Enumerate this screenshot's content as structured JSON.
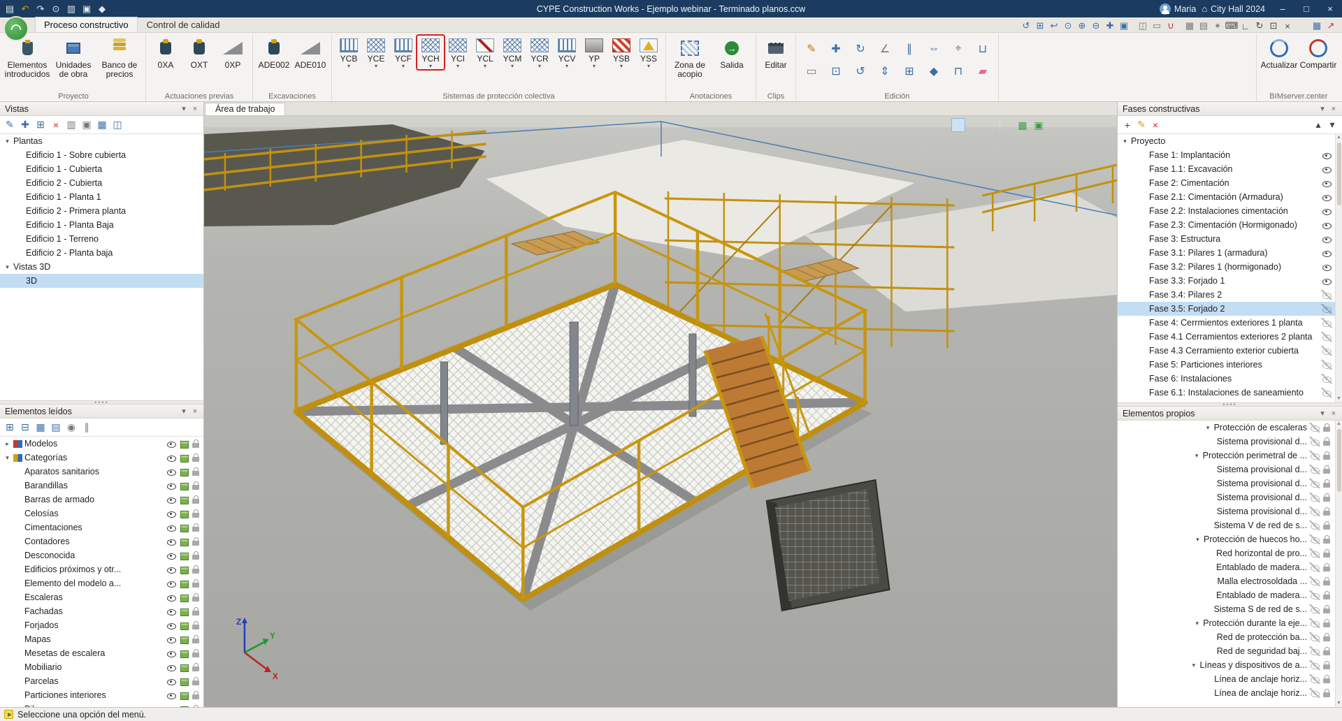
{
  "titlebar": {
    "title": "CYPE Construction Works - Ejemplo webinar - Terminado planos.ccw",
    "user": "Maria",
    "project": "City Hall 2024",
    "icons": [
      {
        "name": "save-icon",
        "glyph": "▤",
        "tone": "light"
      },
      {
        "name": "undo-icon",
        "glyph": "↶",
        "tone": "yellow"
      },
      {
        "name": "redo-icon",
        "glyph": "↷",
        "tone": "light"
      },
      {
        "name": "zoom-icon",
        "glyph": "⊙",
        "tone": "light"
      },
      {
        "name": "print-icon",
        "glyph": "▥",
        "tone": "light"
      },
      {
        "name": "capture-icon",
        "glyph": "▣",
        "tone": "light"
      },
      {
        "name": "settings-icon",
        "glyph": "◆",
        "tone": "light"
      }
    ],
    "window_controls": [
      {
        "name": "minimize-button",
        "glyph": "–"
      },
      {
        "name": "maximize-button",
        "glyph": "□"
      },
      {
        "name": "close-button",
        "glyph": "×"
      }
    ]
  },
  "ribbon_tabs": [
    {
      "label": "Proceso constructivo",
      "active": true
    },
    {
      "label": "Control de calidad"
    }
  ],
  "tabrow_icons": [
    {
      "name": "refresh-view-icon",
      "glyph": "↺",
      "tone": "blue"
    },
    {
      "name": "zoom-window-icon",
      "glyph": "⊞",
      "tone": "blue"
    },
    {
      "name": "zoom-previous-icon",
      "glyph": "↩",
      "tone": "blue"
    },
    {
      "name": "magnifier-icon",
      "glyph": "⊙",
      "tone": "blue"
    },
    {
      "name": "zoom-in-icon",
      "glyph": "⊕",
      "tone": "blue"
    },
    {
      "name": "zoom-out-icon",
      "glyph": "⊖",
      "tone": "blue"
    },
    {
      "name": "pan-icon",
      "glyph": "✚",
      "tone": "blue"
    },
    {
      "name": "full-view-icon",
      "glyph": "▣",
      "tone": "blue"
    },
    {
      "sep": true
    },
    {
      "name": "tile-windows-icon",
      "glyph": "◫",
      "tone": "gray"
    },
    {
      "name": "new-window-icon",
      "glyph": "▭",
      "tone": "gray"
    },
    {
      "name": "magnet-icon",
      "glyph": "∪",
      "tone": "red"
    },
    {
      "sep": true
    },
    {
      "name": "frame-icon",
      "glyph": "▦",
      "tone": "gray"
    },
    {
      "name": "grid-icon",
      "glyph": "▤",
      "tone": "gray"
    },
    {
      "name": "snap-icon",
      "glyph": "⌖",
      "tone": "dark"
    },
    {
      "name": "keyboard-icon",
      "glyph": "⌨",
      "tone": "dark"
    },
    {
      "name": "ruler-icon",
      "glyph": "∟",
      "tone": "dark"
    },
    {
      "name": "orbit-icon",
      "glyph": "↻",
      "tone": "dark"
    },
    {
      "name": "comment-icon",
      "glyph": "⊡",
      "tone": "dark"
    },
    {
      "name": "close-tool-icon",
      "glyph": "×",
      "tone": "dark"
    },
    {
      "gap": true
    },
    {
      "name": "bim-windows-icon",
      "glyph": "▦",
      "tone": "blue"
    },
    {
      "name": "share-view-icon",
      "glyph": "↗",
      "tone": "red"
    }
  ],
  "ribbon": {
    "proyecto": {
      "label": "Proyecto",
      "buttons": [
        {
          "label": "Elementos introducidos",
          "icon": "elements"
        },
        {
          "label": "Unidades de obra",
          "icon": "units"
        },
        {
          "label": "Banco de precios",
          "icon": "prices"
        }
      ]
    },
    "actuaciones": {
      "label": "Actuaciones previas",
      "buttons": [
        {
          "label": "0XA",
          "icon": "ink"
        },
        {
          "label": "OXT",
          "icon": "ink"
        },
        {
          "label": "0XP",
          "icon": "ramp"
        }
      ]
    },
    "excavaciones": {
      "label": "Excavaciones",
      "buttons": [
        {
          "label": "ADE002",
          "icon": "ink"
        },
        {
          "label": "ADE010",
          "icon": "ramp"
        }
      ]
    },
    "proteccion": {
      "label": "Sistemas de protección colectiva",
      "buttons": [
        {
          "code": "YCB",
          "icon": "fence"
        },
        {
          "code": "YCE",
          "icon": "net"
        },
        {
          "code": "YCF",
          "icon": "fence"
        },
        {
          "code": "YCH",
          "icon": "net",
          "highlighted": true
        },
        {
          "code": "YCI",
          "icon": "net"
        },
        {
          "code": "YCL",
          "icon": "line"
        },
        {
          "code": "YCM",
          "icon": "net"
        },
        {
          "code": "YCR",
          "icon": "net"
        },
        {
          "code": "YCV",
          "icon": "fence"
        },
        {
          "code": "YP",
          "icon": "platform"
        },
        {
          "code": "YSB",
          "icon": "stripes"
        },
        {
          "code": "YSS",
          "icon": "sign"
        }
      ]
    },
    "anotaciones": {
      "label": "Anotaciones",
      "buttons": [
        {
          "label": "Zona de acopio",
          "icon": "zone"
        },
        {
          "label": "Salida",
          "icon": "exit"
        }
      ]
    },
    "clips": {
      "label": "Clips",
      "buttons": [
        {
          "label": "Editar",
          "icon": "clip"
        }
      ]
    },
    "edicion": {
      "label": "Edición",
      "tools": [
        {
          "name": "edit-tool-icon",
          "glyph": "✎",
          "tone": "orange"
        },
        {
          "name": "rectangle-tool-icon",
          "glyph": "▭",
          "tone": "gray"
        },
        {
          "name": "move-tool-icon",
          "glyph": "✚",
          "tone": "blue"
        },
        {
          "name": "copy-tool-icon",
          "glyph": "⊡",
          "tone": "blue"
        },
        {
          "name": "rotate-tool-icon",
          "glyph": "↻",
          "tone": "blue"
        },
        {
          "name": "rotate-ccw-tool-icon",
          "glyph": "↺",
          "tone": "blue"
        },
        {
          "name": "measure-tool-icon",
          "glyph": "∠",
          "tone": "gray"
        },
        {
          "name": "stretch-tool-icon",
          "glyph": "⇕",
          "tone": "blue"
        },
        {
          "name": "align-tool-icon",
          "glyph": "∥",
          "tone": "blue"
        },
        {
          "name": "grid-snap-tool-icon",
          "glyph": "⊞",
          "tone": "blue"
        },
        {
          "name": "mirror-tool-icon",
          "glyph": "⇔",
          "tone": "blue"
        },
        {
          "name": "diamond-tool-icon",
          "glyph": "◆",
          "tone": "blue"
        },
        {
          "name": "dimension-tool-icon",
          "glyph": "⌖",
          "tone": "gray"
        },
        {
          "name": "join-tool-icon",
          "glyph": "⊓",
          "tone": "blue"
        },
        {
          "name": "divide-tool-icon",
          "glyph": "⊔",
          "tone": "blue"
        },
        {
          "name": "eraser-tool-icon",
          "glyph": "▰",
          "tone": "pink"
        }
      ]
    },
    "bimserver": {
      "label": "BIMserver.center",
      "buttons": [
        {
          "label": "Actualizar",
          "icon": "sync"
        },
        {
          "label": "Compartir",
          "icon": "share"
        }
      ]
    }
  },
  "workspace": {
    "tab": "Área de trabajo",
    "toolbar": [
      {
        "name": "projection-icon",
        "glyph": "△"
      },
      {
        "name": "perspective-icon",
        "glyph": "◇",
        "active": true
      },
      {
        "name": "visibility-icon",
        "glyph": "◉"
      },
      {
        "name": "orbit-icon",
        "glyph": "↻"
      },
      {
        "sep": true
      },
      {
        "name": "analytical-model-icon",
        "glyph": "▦",
        "tone": "green"
      },
      {
        "name": "solid-view-icon",
        "glyph": "▣",
        "tone": "green"
      },
      {
        "name": "background-icon",
        "glyph": "▭"
      },
      {
        "name": "layers-icon",
        "glyph": "≡"
      },
      {
        "name": "hide-elements-icon",
        "glyph": "◌"
      },
      {
        "name": "isolate-icon",
        "glyph": "◆"
      }
    ],
    "axis_labels": {
      "x": "X",
      "y": "Y",
      "z": "Z"
    }
  },
  "panels": {
    "vistas": {
      "title": "Vistas",
      "toolbar": [
        {
          "name": "edit-view-icon",
          "glyph": "✎",
          "tone": "blue"
        },
        {
          "name": "new-view-icon",
          "glyph": "✚",
          "tone": "blue"
        },
        {
          "name": "duplicate-view-icon",
          "glyph": "⊞",
          "tone": "blue"
        },
        {
          "name": "delete-view-icon",
          "glyph": "×",
          "tone": "red"
        },
        {
          "name": "print-view-icon",
          "glyph": "▥",
          "tone": "gray"
        },
        {
          "name": "capture-view-icon",
          "glyph": "▣",
          "tone": "gray"
        },
        {
          "name": "layers-view-icon",
          "glyph": "▦",
          "tone": "blue"
        },
        {
          "name": "export-view-icon",
          "glyph": "◫",
          "tone": "blue"
        }
      ],
      "items": [
        {
          "label": "Plantas",
          "arrow": "down"
        },
        {
          "label": "Edificio 1 - Sobre cubierta",
          "indent": 1
        },
        {
          "label": "Edificio 1 - Cubierta",
          "indent": 1
        },
        {
          "label": "Edificio 2 - Cubierta",
          "indent": 1
        },
        {
          "label": "Edificio 1 - Planta 1",
          "indent": 1
        },
        {
          "label": "Edificio 2 - Primera planta",
          "indent": 1
        },
        {
          "label": "Edificio 1 - Planta Baja",
          "indent": 1
        },
        {
          "label": "Edificio 1 - Terreno",
          "indent": 1
        },
        {
          "label": "Edificio 2 - Planta baja",
          "indent": 1
        },
        {
          "label": "Vistas 3D",
          "arrow": "down"
        },
        {
          "label": "3D",
          "indent": 1,
          "selected": true
        }
      ]
    },
    "leidos": {
      "title": "Elementos leídos",
      "toolbar": [
        {
          "name": "expand-all-icon",
          "glyph": "⊞",
          "tone": "blue"
        },
        {
          "name": "collapse-all-icon",
          "glyph": "⊟",
          "tone": "blue"
        },
        {
          "name": "show-all-icon",
          "glyph": "▦",
          "tone": "blue"
        },
        {
          "name": "hide-all-icon",
          "glyph": "▤",
          "tone": "blue"
        },
        {
          "name": "sphere-icon",
          "glyph": "◉",
          "tone": "gray"
        },
        {
          "name": "filter-icon",
          "glyph": "∥",
          "tone": "gray"
        }
      ],
      "items": [
        {
          "label": "Modelos",
          "arrow": "right",
          "icon": "models",
          "eye": "on",
          "cube": true,
          "lock": true
        },
        {
          "label": "Categorías",
          "arrow": "down",
          "icon": "categories",
          "eye": "on",
          "cube": true,
          "lock": true
        },
        {
          "label": "Aparatos sanitarios",
          "eye": "on",
          "cube": true,
          "lock": true
        },
        {
          "label": "Barandillas",
          "eye": "on",
          "cube": true,
          "lock": true
        },
        {
          "label": "Barras de armado",
          "eye": "on",
          "cube": true,
          "lock": true
        },
        {
          "label": "Celosías",
          "eye": "on",
          "cube": true,
          "lock": true
        },
        {
          "label": "Cimentaciones",
          "eye": "on",
          "cube": true,
          "lock": true
        },
        {
          "label": "Contadores",
          "eye": "on",
          "cube": true,
          "lock": true
        },
        {
          "label": "Desconocida",
          "eye": "on",
          "cube": true,
          "lock": true
        },
        {
          "label": "Edificios próximos y otr...",
          "eye": "on",
          "cube": true,
          "lock": true
        },
        {
          "label": "Elemento del modelo a...",
          "eye": "on",
          "cube": true,
          "lock": true
        },
        {
          "label": "Escaleras",
          "eye": "on",
          "cube": true,
          "lock": true
        },
        {
          "label": "Fachadas",
          "eye": "on",
          "cube": true,
          "lock": true
        },
        {
          "label": "Forjados",
          "eye": "on",
          "cube": true,
          "lock": true
        },
        {
          "label": "Mapas",
          "eye": "on",
          "cube": true,
          "lock": true
        },
        {
          "label": "Mesetas de escalera",
          "eye": "on",
          "cube": true,
          "lock": true
        },
        {
          "label": "Mobiliario",
          "eye": "on",
          "cube": true,
          "lock": true
        },
        {
          "label": "Parcelas",
          "eye": "on",
          "cube": true,
          "lock": true
        },
        {
          "label": "Particiones interiores",
          "eye": "on",
          "cube": true,
          "lock": true
        },
        {
          "label": "Pilares",
          "eye": "on",
          "cube": true,
          "lock": true
        }
      ]
    },
    "fases": {
      "title": "Fases constructivas",
      "toolbar": [
        {
          "name": "add-phase-icon",
          "glyph": "+",
          "tone": "dark"
        },
        {
          "name": "edit-phase-icon",
          "glyph": "✎",
          "tone": "yellow"
        },
        {
          "name": "delete-phase-icon",
          "glyph": "×",
          "tone": "red"
        }
      ],
      "toolbar_right": [
        {
          "name": "move-up-icon",
          "glyph": "▴",
          "tone": "dark"
        },
        {
          "name": "move-down-icon",
          "glyph": "▾",
          "tone": "dark"
        }
      ],
      "items": [
        {
          "label": "Proyecto",
          "arrow": "down"
        },
        {
          "label": "Fase 1: Implantación",
          "indent": 1,
          "eye": "on"
        },
        {
          "label": "Fase 1.1: Excavación",
          "indent": 1,
          "eye": "on"
        },
        {
          "label": "Fase 2: Cimentación",
          "indent": 1,
          "eye": "on"
        },
        {
          "label": "Fase 2.1: Cimentación (Armadura)",
          "indent": 1,
          "eye": "on"
        },
        {
          "label": "Fase 2.2: Instalaciones cimentación",
          "indent": 1,
          "eye": "on"
        },
        {
          "label": "Fase 2.3: Cimentación (Hormigonado)",
          "indent": 1,
          "eye": "on"
        },
        {
          "label": "Fase 3: Estructura",
          "indent": 1,
          "eye": "on"
        },
        {
          "label": "Fase 3.1: Pilares 1 (armadura)",
          "indent": 1,
          "eye": "on"
        },
        {
          "label": "Fase 3.2: Pilares 1 (hormigonado)",
          "indent": 1,
          "eye": "on"
        },
        {
          "label": "Fase 3.3: Forjado 1",
          "indent": 1,
          "eye": "on"
        },
        {
          "label": "Fase 3.4: Pilares 2",
          "indent": 1,
          "eye": "off"
        },
        {
          "label": "Fase 3.5: Forjado 2",
          "indent": 1,
          "eye": "off",
          "selected": true
        },
        {
          "label": "Fase 4: Cerrmientos exteriores 1 planta",
          "indent": 1,
          "eye": "off"
        },
        {
          "label": "Fase 4.1 Cerramientos exteriores 2 planta",
          "indent": 1,
          "eye": "off"
        },
        {
          "label": "Fase 4.3 Cerramiento exterior cubierta",
          "indent": 1,
          "eye": "off"
        },
        {
          "label": "Fase 5: Particiones interiores",
          "indent": 1,
          "eye": "off"
        },
        {
          "label": "Fase 6: Instalaciones",
          "indent": 1,
          "eye": "off"
        },
        {
          "label": "Fase 6.1: Instalaciones de saneamiento",
          "indent": 1,
          "eye": "off"
        }
      ]
    },
    "propios": {
      "title": "Elementos propios",
      "items": [
        {
          "label": "Protección de escaleras",
          "arrow": "down",
          "group": true,
          "eye": "off",
          "lock": true
        },
        {
          "label": "Sistema provisional d...",
          "child": true,
          "eye": "off",
          "lock": true
        },
        {
          "label": "Protección perimetral de ...",
          "arrow": "down",
          "group": true,
          "eye": "off",
          "lock": true
        },
        {
          "label": "Sistema provisional d...",
          "child": true,
          "eye": "off",
          "lock": true
        },
        {
          "label": "Sistema provisional d...",
          "child": true,
          "eye": "off",
          "lock": true
        },
        {
          "label": "Sistema provisional d...",
          "child": true,
          "eye": "off",
          "lock": true
        },
        {
          "label": "Sistema provisional d...",
          "child": true,
          "eye": "off",
          "lock": true
        },
        {
          "label": "Sistema V de red de s...",
          "child": true,
          "eye": "off",
          "lock": true
        },
        {
          "label": "Protección de huecos ho...",
          "arrow": "down",
          "group": true,
          "eye": "off",
          "lock": true
        },
        {
          "label": "Red horizontal de pro...",
          "child": true,
          "eye": "off",
          "lock": true
        },
        {
          "label": "Entablado de madera...",
          "child": true,
          "eye": "off",
          "lock": true
        },
        {
          "label": "Malla electrosoldada ...",
          "child": true,
          "eye": "off",
          "lock": true
        },
        {
          "label": "Entablado de madera...",
          "child": true,
          "eye": "off",
          "lock": true
        },
        {
          "label": "Sistema S de red de s...",
          "child": true,
          "eye": "off",
          "lock": true
        },
        {
          "label": "Protección durante la eje...",
          "arrow": "down",
          "group": true,
          "eye": "off",
          "lock": true
        },
        {
          "label": "Red de protección ba...",
          "child": true,
          "eye": "off",
          "lock": true
        },
        {
          "label": "Red de seguridad baj...",
          "child": true,
          "eye": "off",
          "lock": true
        },
        {
          "label": "Líneas y dispositivos de a...",
          "arrow": "down",
          "group": true,
          "eye": "off",
          "lock": true
        },
        {
          "label": "Línea de anclaje horiz...",
          "child": true,
          "eye": "off",
          "lock": true
        },
        {
          "label": "Línea de anclaje horiz...",
          "child": true,
          "eye": "off",
          "lock": true
        }
      ]
    }
  },
  "statusbar": {
    "message": "Seleccione una opción del menú."
  },
  "colors": {
    "titlebar": "#1b3c60",
    "selection": "#c3ddf3",
    "highlight_box": "#d42020",
    "scaffold_yellow": "#c8960e",
    "accent_blue": "#3a6ea8"
  }
}
